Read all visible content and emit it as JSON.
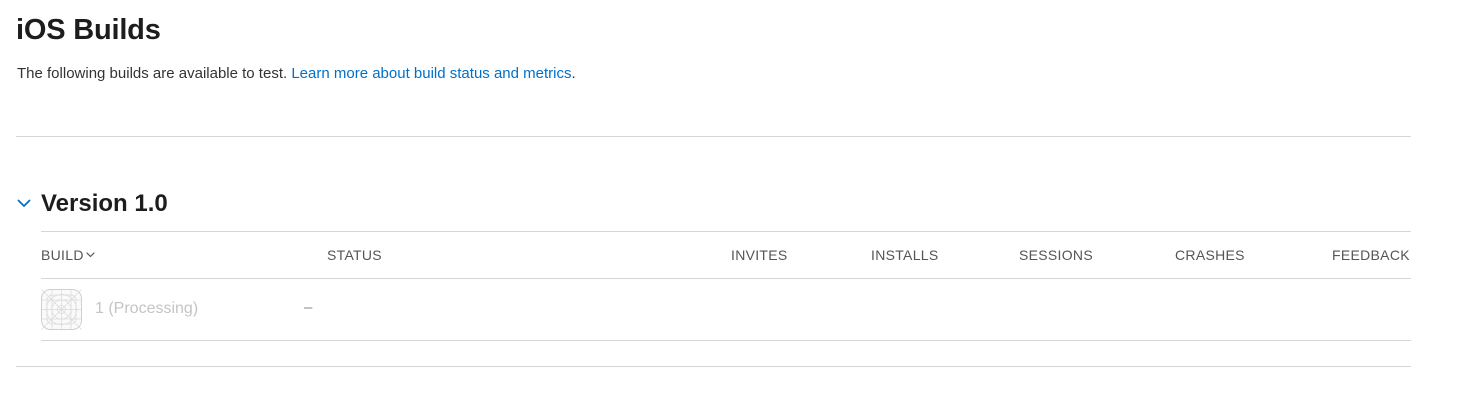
{
  "header": {
    "title": "iOS Builds",
    "intro_text": "The following builds are available to test. ",
    "intro_link": "Learn more about build status and metrics",
    "intro_suffix": "."
  },
  "version_group": {
    "title": "Version 1.0",
    "expanded": true,
    "toggle_icon": "chevron-down-icon",
    "columns": {
      "build": "BUILD",
      "status": "STATUS",
      "invites": "INVITES",
      "installs": "INSTALLS",
      "sessions": "SESSIONS",
      "crashes": "CRASHES",
      "feedback": "FEEDBACK"
    },
    "build_sort_icon": "chevron-down-icon",
    "builds": [
      {
        "icon": "app-placeholder-icon",
        "name": "1 (Processing)",
        "status": "–"
      }
    ]
  },
  "colors": {
    "link": "#0070c9",
    "divider": "#d6d6d6",
    "muted_text": "#c4c4c6"
  }
}
